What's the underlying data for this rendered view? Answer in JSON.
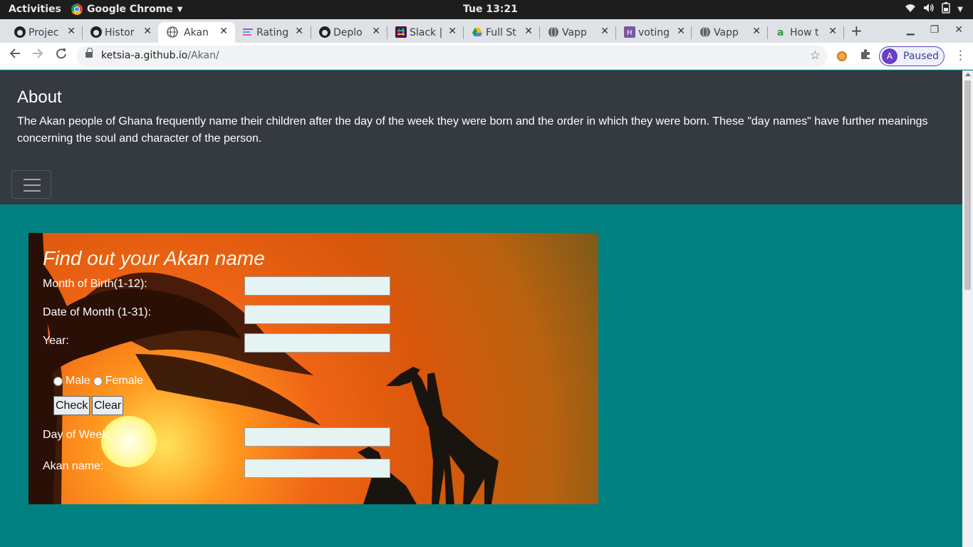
{
  "system": {
    "activities": "Activities",
    "app_name": "Google Chrome",
    "clock": "Tue 13:21"
  },
  "tabs": [
    {
      "title": "Projec",
      "icon": "github-icon"
    },
    {
      "title": "Histor",
      "icon": "github-icon"
    },
    {
      "title": "Akan N",
      "icon": "globe-icon",
      "active": true
    },
    {
      "title": "Rating",
      "icon": "rating-icon"
    },
    {
      "title": "Deplo",
      "icon": "github-icon"
    },
    {
      "title": "Slack |",
      "icon": "slack-icon"
    },
    {
      "title": "Full St",
      "icon": "drive-icon"
    },
    {
      "title": "Vapp",
      "icon": "globe-icon"
    },
    {
      "title": "voting",
      "icon": "heroku-icon"
    },
    {
      "title": "Vapp",
      "icon": "globe-icon"
    },
    {
      "title": "How t",
      "icon": "answers-icon"
    }
  ],
  "browser": {
    "url_host": "ketsia-a.github.io",
    "url_path": "/Akan/",
    "profile_initial": "A",
    "profile_status": "Paused"
  },
  "header": {
    "title": "About",
    "description": "The Akan people of Ghana frequently name their children after the day of the week they were born and the order in which they were born. These \"day names\" have further meanings concerning the soul and character of the person."
  },
  "form": {
    "title": "Find out your Akan name",
    "month_label": "Month of Birth(1-12):",
    "month_value": "",
    "date_label": "Date of Month (1-31):",
    "date_value": "",
    "year_label": "Year:",
    "year_value": "",
    "gender_male": "Male",
    "gender_female": "Female",
    "check_button": "Check",
    "clear_button": "Clear",
    "day_label": "Day of Week:",
    "day_value": "",
    "akan_label": "Akan name:",
    "akan_value": ""
  },
  "colors": {
    "header_bg": "#343a40",
    "page_bg": "#008080"
  }
}
